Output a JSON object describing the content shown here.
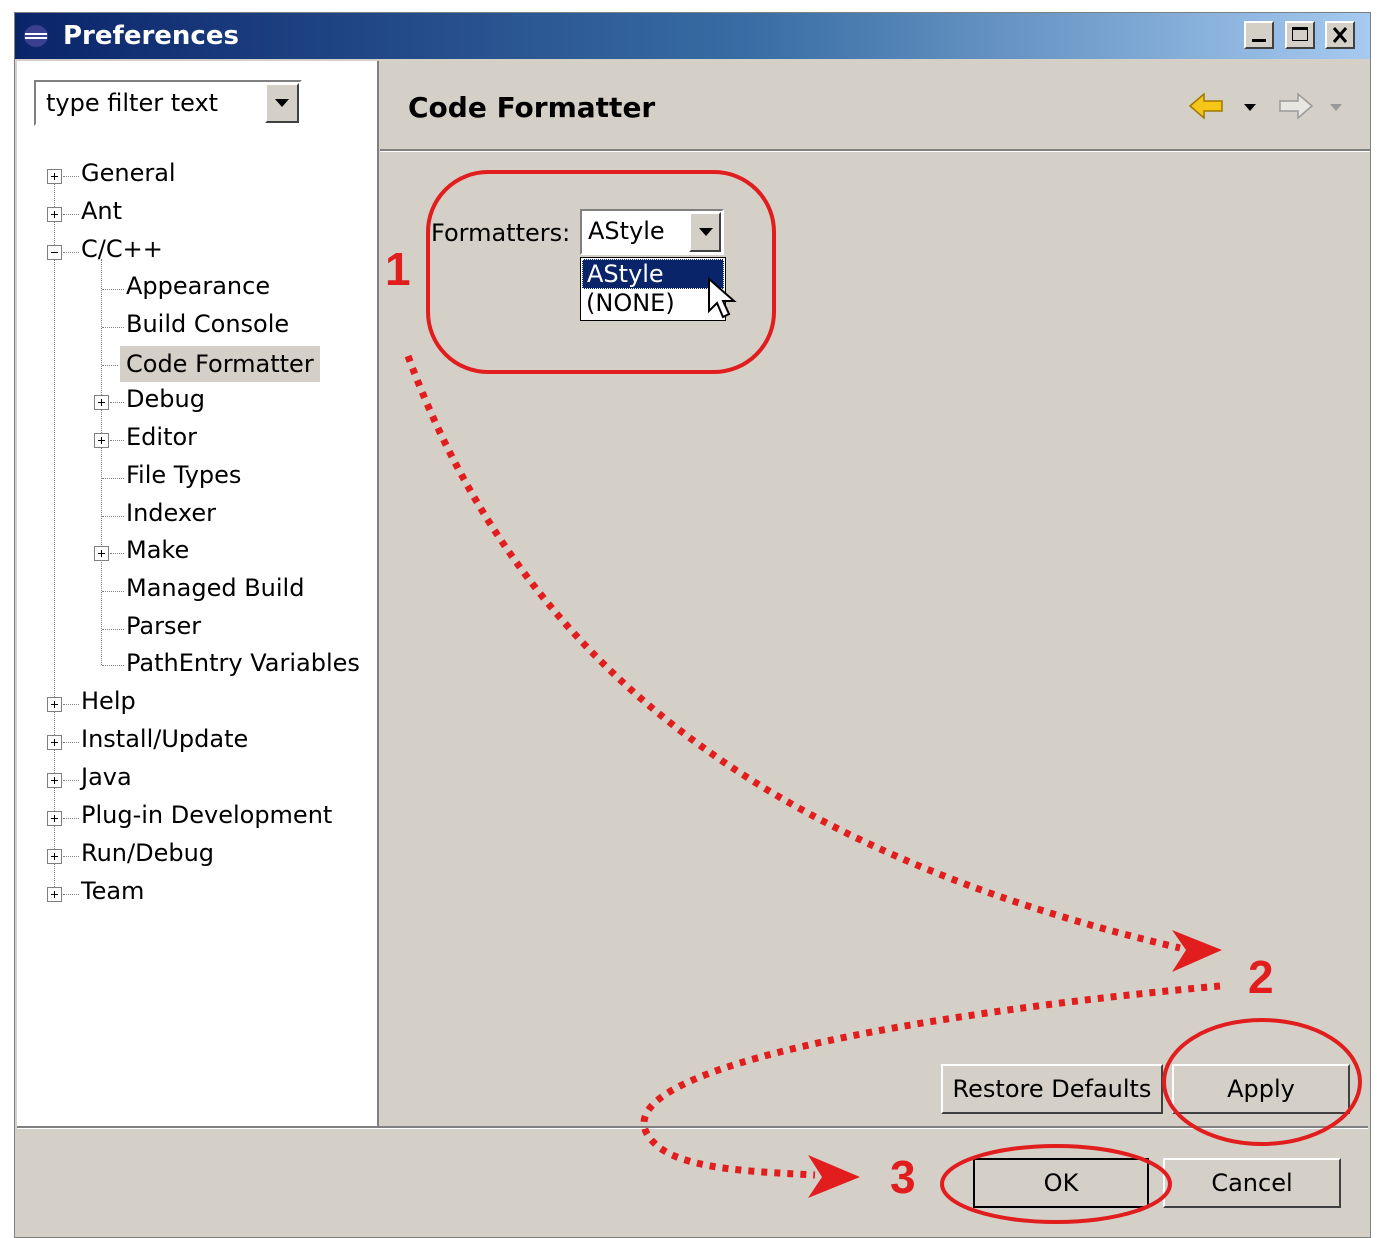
{
  "window": {
    "title": "Preferences"
  },
  "filter": {
    "value": "type filter text"
  },
  "tree": {
    "items": [
      {
        "label": "General"
      },
      {
        "label": "Ant"
      },
      {
        "label": "C/C++"
      },
      {
        "label": "Appearance"
      },
      {
        "label": "Build Console"
      },
      {
        "label": "Code Formatter"
      },
      {
        "label": "Debug"
      },
      {
        "label": "Editor"
      },
      {
        "label": "File Types"
      },
      {
        "label": "Indexer"
      },
      {
        "label": "Make"
      },
      {
        "label": "Managed Build"
      },
      {
        "label": "Parser"
      },
      {
        "label": "PathEntry Variables"
      },
      {
        "label": "Help"
      },
      {
        "label": "Install/Update"
      },
      {
        "label": "Java"
      },
      {
        "label": "Plug-in Development"
      },
      {
        "label": "Run/Debug"
      },
      {
        "label": "Team"
      }
    ]
  },
  "page": {
    "title": "Code Formatter",
    "formatters_label": "Formatters:",
    "formatter_value": "AStyle",
    "formatter_options": [
      "AStyle",
      "(NONE)"
    ]
  },
  "buttons": {
    "restore_defaults": "Restore Defaults",
    "apply": "Apply",
    "ok": "OK",
    "cancel": "Cancel"
  },
  "annotations": {
    "step1": "1",
    "step2": "2",
    "step3": "3"
  },
  "colors": {
    "annotation": "#e11d1d",
    "selection": "#0a246a",
    "titlebar": "#0a246a"
  }
}
